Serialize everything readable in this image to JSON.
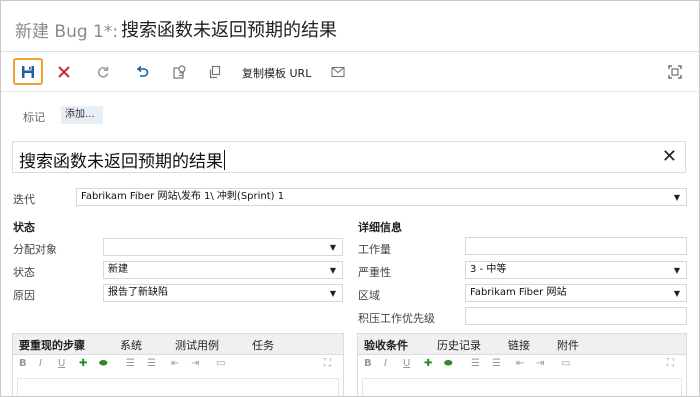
{
  "title": {
    "prefix": "新建 Bug 1*:",
    "text": "搜索函数未返回预期的结果"
  },
  "toolbar": {
    "save": "save-icon",
    "discard": "close-icon",
    "refresh": "refresh-icon",
    "undo": "undo-icon",
    "settings": "settings-icon",
    "copy": "copy-icon",
    "copy_template_url": "复制模板 URL",
    "email": "email-icon",
    "fullscreen": "fullscreen-icon",
    "accent": "#f0a030"
  },
  "tags": {
    "label": "标记",
    "add": "添加..."
  },
  "work_item_title": "搜索函数未返回预期的结果",
  "iteration": {
    "label": "迭代",
    "value": "Fabrikam Fiber 网站\\发布 1\\ 冲刺(Sprint) 1"
  },
  "status_section": {
    "heading": "状态",
    "assigned_label": "分配对象",
    "assigned_value": "",
    "state_label": "状态",
    "state_value": "新建",
    "reason_label": "原因",
    "reason_value": "报告了新缺陷"
  },
  "details_section": {
    "heading": "详细信息",
    "effort_label": "工作量",
    "effort_value": "",
    "severity_label": "严重性",
    "severity_value": "3 - 中等",
    "area_label": "区域",
    "area_value": "Fabrikam Fiber 网站",
    "backlog_label": "积压工作优先级"
  },
  "left_panel": {
    "tabs": [
      "要重现的步骤",
      "系统",
      "测试用例",
      "任务"
    ]
  },
  "right_panel": {
    "tabs": [
      "验收条件",
      "历史记录",
      "链接",
      "附件"
    ]
  }
}
